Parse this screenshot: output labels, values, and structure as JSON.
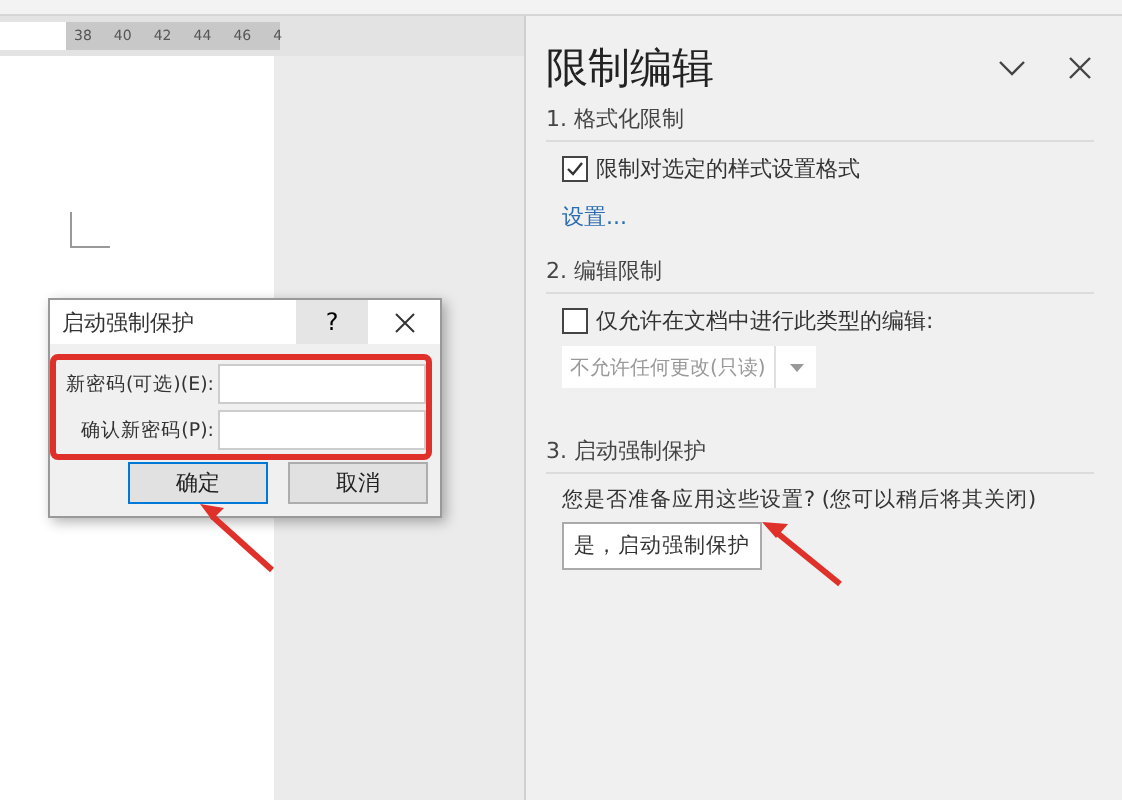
{
  "ruler": {
    "labels": [
      "38",
      "40",
      "42",
      "44",
      "46",
      "4"
    ]
  },
  "dialog": {
    "title": "启动强制保护",
    "help": "?",
    "fields": [
      {
        "label": "新密码(可选)(E):"
      },
      {
        "label": "确认新密码(P):"
      }
    ],
    "buttons": [
      {
        "label": "确定",
        "selected": true
      },
      {
        "label": "取消",
        "selected": false
      }
    ]
  },
  "pane": {
    "title": "限制编辑",
    "sections": [
      {
        "heading": "1. 格式化限制",
        "items": [
          {
            "kind": "checkbox",
            "label": "限制对选定的样式设置格式",
            "checked": true
          },
          {
            "kind": "link",
            "label": "设置..."
          }
        ]
      },
      {
        "heading": "2. 编辑限制",
        "items": [
          {
            "kind": "checkbox",
            "label": "仅允许在文档中进行此类型的编辑:",
            "checked": false
          },
          {
            "kind": "dropdown",
            "value": "不允许任何更改(只读)",
            "disabled": true
          }
        ]
      },
      {
        "heading": "3. 启动强制保护",
        "items": [
          {
            "kind": "text",
            "label": "您是否准备应用这些设置? (您可以稍后将其关闭)"
          },
          {
            "kind": "button",
            "label": "是，启动强制保护"
          }
        ]
      }
    ]
  }
}
